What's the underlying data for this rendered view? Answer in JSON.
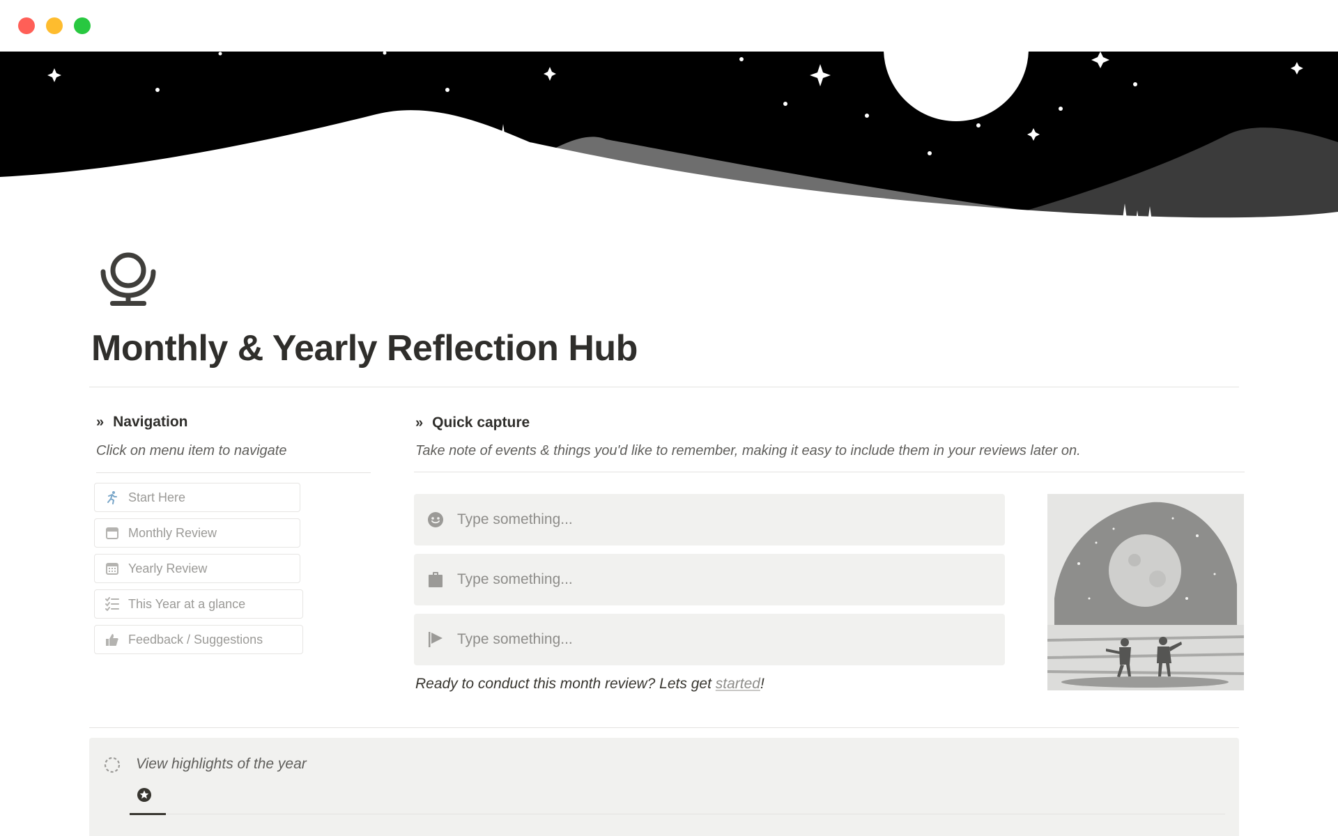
{
  "window": {
    "controls": [
      "close-button",
      "minimize-button",
      "zoom-button"
    ]
  },
  "page": {
    "icon": "mirror-icon",
    "title": "Monthly & Yearly Reflection Hub"
  },
  "navigation": {
    "heading_marker": "»",
    "heading": "Navigation",
    "subtitle": "Click on menu item to navigate",
    "items": [
      {
        "label": "Start Here",
        "icon": "running-person-icon"
      },
      {
        "label": "Monthly Review",
        "icon": "calendar-icon"
      },
      {
        "label": "Yearly Review",
        "icon": "calendar-grid-icon"
      },
      {
        "label": "This Year at a glance",
        "icon": "checklist-icon"
      },
      {
        "label": "Feedback / Suggestions",
        "icon": "thumbs-up-icon"
      }
    ]
  },
  "quick_capture": {
    "heading_marker": "»",
    "heading": "Quick capture",
    "subtitle": "Take note of events & things you'd like to remember, making it easy to include them in your reviews later on.",
    "inputs": [
      {
        "placeholder": "Type something...",
        "value": "",
        "icon": "smiley-icon"
      },
      {
        "placeholder": "Type something...",
        "value": "",
        "icon": "clipboard-icon"
      },
      {
        "placeholder": "Type something...",
        "value": "",
        "icon": "flag-icon"
      }
    ],
    "cta_prefix": "Ready to conduct this month review? Lets get ",
    "cta_link": "started",
    "cta_suffix": "!"
  },
  "highlights": {
    "label": "View highlights of the year",
    "icon": "dashed-circle-icon",
    "tab_icon": "star-badge-icon"
  },
  "colors": {
    "text": "#37352f",
    "muted": "#9b9a97",
    "input_bg": "#f1f1ef",
    "divider": "#e3e2e0",
    "cover_sky": "#000000"
  }
}
